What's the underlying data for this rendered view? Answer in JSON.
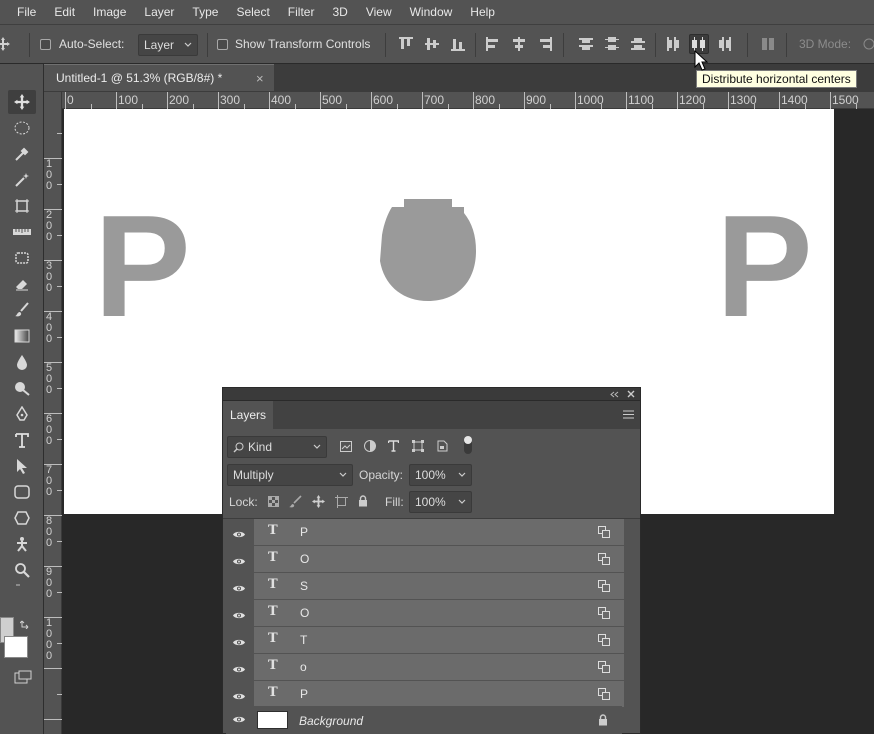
{
  "menu": [
    "File",
    "Edit",
    "Image",
    "Layer",
    "Type",
    "Select",
    "Filter",
    "3D",
    "View",
    "Window",
    "Help"
  ],
  "options": {
    "auto_select_label": "Auto-Select:",
    "auto_select_value": "Layer",
    "show_transform_label": "Show Transform Controls",
    "mode_3d_label": "3D Mode:"
  },
  "tooltip": "Distribute horizontal centers",
  "document": {
    "tab_title": "Untitled-1 @ 51.3% (RGB/8#) *",
    "close_glyph": "×"
  },
  "ruler": {
    "h_ticks": [
      "0",
      "100",
      "200",
      "300",
      "400",
      "500",
      "600",
      "700",
      "800",
      "900",
      "1000",
      "1100",
      "1200",
      "1300",
      "1400",
      "1500"
    ],
    "v_ticks": [
      "1\n0\n0",
      "2\n0\n0",
      "3\n0\n0",
      "4\n0\n0",
      "5\n0\n0",
      "6\n0\n0",
      "7\n0\n0",
      "8\n0\n0",
      "9\n0\n0",
      "1\n0\n0\n0"
    ]
  },
  "canvas_text": {
    "left": "P",
    "right": "P"
  },
  "layers_panel": {
    "tab": "Layers",
    "filter_kind": "Kind",
    "blend_mode": "Multiply",
    "opacity_label": "Opacity:",
    "opacity_value": "100%",
    "lock_label": "Lock:",
    "fill_label": "Fill:",
    "fill_value": "100%",
    "type_glyph": "T",
    "layers": [
      {
        "name": "P"
      },
      {
        "name": "O"
      },
      {
        "name": "S"
      },
      {
        "name": "O"
      },
      {
        "name": "T"
      },
      {
        "name": "o"
      },
      {
        "name": "P"
      }
    ],
    "background_name": "Background"
  },
  "colors": {
    "ui": "#535353",
    "canvas": "#ffffff",
    "glyph": "#9a9a9a",
    "tooltip": "#ffffe1",
    "layer_row": "#6b6b6b"
  }
}
